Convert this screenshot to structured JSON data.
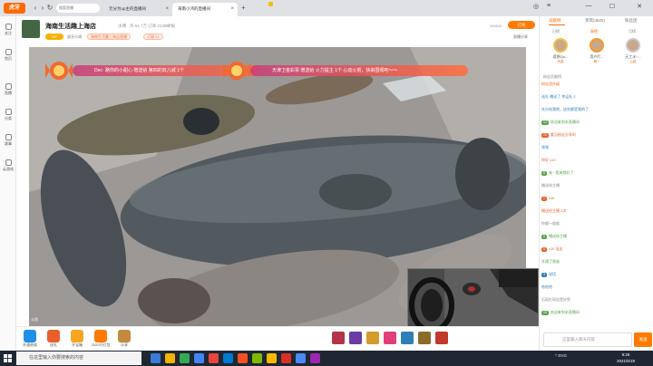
{
  "browser": {
    "logo": "虎牙",
    "url_placeholder": "搜索直播",
    "tabs": [
      {
        "label": "元分为up主的直播间"
      },
      {
        "label": "海南小鸿的直播间"
      }
    ],
    "window_controls": [
      "—",
      "☐",
      "✕"
    ]
  },
  "sidebar": {
    "items": [
      {
        "label": "关注",
        "icon": "follow-icon"
      },
      {
        "label": "首页",
        "icon": "home-icon"
      },
      {
        "label": "直播",
        "icon": "live-icon"
      },
      {
        "label": "分类",
        "icon": "category-icon"
      },
      {
        "label": "赛事",
        "icon": "match-icon"
      },
      {
        "label": "云游戏",
        "icon": "cloud-game-icon"
      }
    ]
  },
  "room": {
    "title": "海南生活趣上海店",
    "streamer": "小鸿",
    "heat": "热 64.7万",
    "fans": "订阅 21396",
    "report": "举报",
    "vip_badge": "VIP",
    "platform": "虎牙小鸿",
    "tag": "海南生活趣上海店直播",
    "sub_tag": "订阅 21",
    "room_id": "345642",
    "subscribe_label": "订阅",
    "share_label": "直播分享"
  },
  "video": {
    "banners": [
      "Dec· 路你的小甜心 赠送给 第四的双儿城 1个",
      "天津卫金彩票 赠送给 火力提主 1个 心动火箭，快来围观吧～～"
    ],
    "overlay_label": "斗鱼",
    "pip_caption": "WWUUU/II"
  },
  "gifts": [
    {
      "label": "开通贵族",
      "color": "#1f8fe8"
    },
    {
      "label": "送礼",
      "color": "#e85f2c"
    },
    {
      "label": "开宝箱",
      "color": "#f5a623"
    },
    {
      "label": "2020开红包",
      "color": "#ff7a00"
    },
    {
      "label": "乐享",
      "color": "#c48a3b"
    }
  ],
  "gift_shelf_colors": [
    "#b2354a",
    "#6b3aa5",
    "#d49a2a",
    "#e23f7a",
    "#2e7fb6",
    "#8c6a2a",
    "#c0392b"
  ],
  "right_panel": {
    "tabs": [
      "贡献榜",
      "贵宾(4525)",
      "粉丝团"
    ],
    "subtabs": [
      "日榜",
      "周榜",
      "月榜"
    ],
    "podium": [
      {
        "name": "君想Qu...",
        "badge": "贵族"
      },
      {
        "name": "用户吖...",
        "badge": "第一"
      },
      {
        "name": "天工水~...",
        "badge": "公爵"
      }
    ],
    "rank_tip": "粉丝贡献榜",
    "messages": [
      {
        "level": "",
        "user": "",
        "text": "",
        "gift": "粉丝团升级",
        "color": "#ff7a00"
      },
      {
        "level": "",
        "user": "",
        "text": "送礼 赠送了 幸运礼 2",
        "gift": "",
        "color": "#2e7fb6"
      },
      {
        "level": "",
        "user": "",
        "text": "先分给我吧，这些都是我的了",
        "gift": "",
        "color": "#2e7fb6"
      },
      {
        "level": "14",
        "user": "",
        "text": "欢迎来到本直播间",
        "gift": "",
        "color": "#57a54b"
      },
      {
        "level": "20",
        "user": "",
        "text": "看见粉丝分享吗",
        "gift": "",
        "color": "#e85f2c"
      },
      {
        "level": "",
        "user": "嘿嘿",
        "text": "",
        "gift": "",
        "color": "#888"
      },
      {
        "level": "",
        "user": "",
        "text": "你好 x10",
        "gift": "",
        "color": "#e85f2c"
      },
      {
        "level": "8",
        "user": "",
        "text": "来~ 我来就好了",
        "gift": "",
        "color": "#57a54b"
      },
      {
        "level": "",
        "user": "",
        "text": "赠送给主播",
        "gift": "",
        "color": "#888"
      },
      {
        "level": "1",
        "user": "",
        "text": "x10",
        "gift": "",
        "color": "#e85f2c"
      },
      {
        "level": "",
        "user": "",
        "text": "赠送给主播 2次",
        "gift": "",
        "color": "#e85f2c"
      },
      {
        "level": "",
        "user": "",
        "text": "你都一般般",
        "gift": "",
        "color": "#888"
      },
      {
        "level": "9",
        "user": "",
        "text": "赠送给主播",
        "gift": "",
        "color": "#57a54b"
      },
      {
        "level": "5",
        "user": "",
        "text": "x10 连击",
        "gift": "",
        "color": "#e85f2c"
      },
      {
        "level": "",
        "user": "",
        "text": "开通了贵族",
        "gift": "",
        "color": "#57a54b"
      },
      {
        "level": "3",
        "user": "",
        "text": "说话",
        "gift": "",
        "color": "#2e7fb6"
      },
      {
        "level": "",
        "user": "",
        "text": "哈哈哈",
        "gift": "",
        "color": "#2e7fb6"
      },
      {
        "level": "",
        "user": "",
        "text": "石斑红斑这是好鱼",
        "gift": "",
        "color": "#888"
      },
      {
        "level": "28",
        "user": "",
        "text": "欢迎来到本直播间",
        "gift": "",
        "color": "#57a54b"
      }
    ],
    "input_placeholder": "这里输入聊天内容",
    "send_label": "发送"
  },
  "taskbar": {
    "search_placeholder": "在这里输入你要搜索的内容",
    "app_colors": [
      "#3a7bd5",
      "#f2b400",
      "#34a853",
      "#4285f4",
      "#e8453c",
      "#0078d4",
      "#f25022",
      "#7fba00",
      "#ffb900",
      "#d93025",
      "#4b8bf5",
      "#9c27b0"
    ],
    "tray": "^ ENG",
    "time": "9:26",
    "date": "2021/5/19"
  }
}
